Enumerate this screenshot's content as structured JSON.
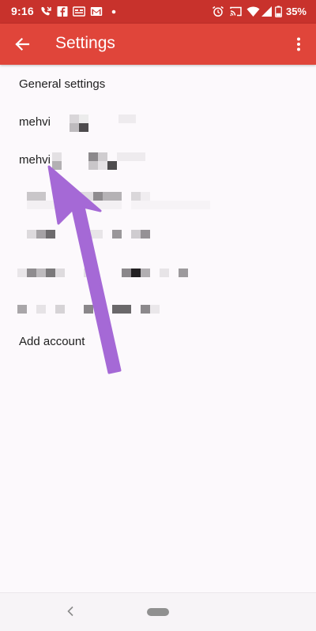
{
  "status_bar": {
    "time": "9:16",
    "battery": "35%",
    "icons": [
      "missed-call-icon",
      "facebook-icon",
      "news-icon",
      "gmail-icon",
      "dot-icon",
      "alarm-icon",
      "cast-icon",
      "wifi-icon",
      "signal-icon",
      "battery-icon"
    ]
  },
  "app_bar": {
    "title": "Settings",
    "back_icon": "arrow-back-icon",
    "overflow_icon": "more-vert-icon",
    "color": "#e0453a"
  },
  "list": {
    "general_settings": "General settings",
    "accounts": [
      {
        "label": "mehvi",
        "redacted": true
      },
      {
        "label": "mehvi",
        "redacted": true
      },
      {
        "label": "",
        "redacted": true
      },
      {
        "label": "",
        "redacted": true
      },
      {
        "label": "",
        "redacted": true
      },
      {
        "label": "",
        "redacted": true
      }
    ],
    "add_account": "Add account"
  },
  "annotation": {
    "type": "arrow",
    "color": "#a569d6",
    "points_to": "account-item-2"
  },
  "nav_bar": {
    "back_icon": "nav-back-icon",
    "home_icon": "home-pill-icon"
  }
}
